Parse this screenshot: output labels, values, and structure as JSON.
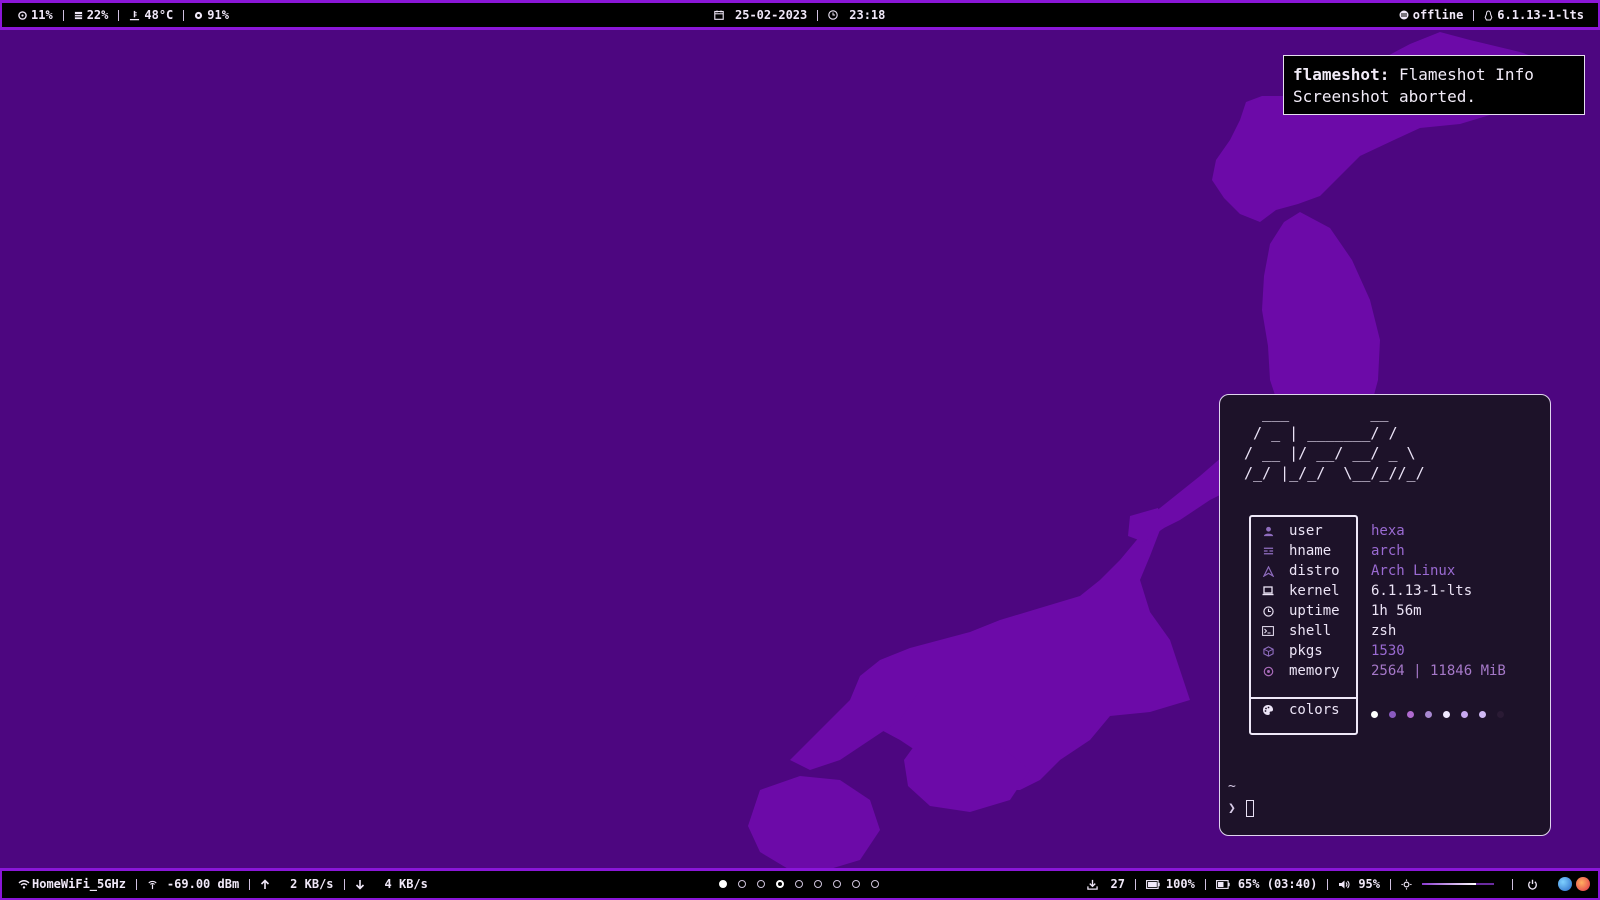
{
  "topbar": {
    "cpu": "11%",
    "ram": "22%",
    "temp": "48°C",
    "brightness": "91%",
    "date": "25-02-2023",
    "time": "23:18",
    "vpn_status": "offline",
    "kernel": "6.1.13-1-lts"
  },
  "notification": {
    "app": "flameshot:",
    "summary": "Flameshot Info",
    "body": "Screenshot aborted."
  },
  "terminal": {
    "ascii_logo": "  ___         __\n / _ | _______/ /\n/ __ |/ __/ __/ _ \\\n/_/ |_/_/  \\__/_//_/",
    "info": [
      {
        "key": "user",
        "value": "hexa",
        "icon": "user-icon"
      },
      {
        "key": "hname",
        "value": "arch",
        "icon": "hostname-icon"
      },
      {
        "key": "distro",
        "value": "Arch Linux",
        "icon": "distro-icon"
      },
      {
        "key": "kernel",
        "value": "6.1.13-1-lts",
        "icon": "laptop-icon"
      },
      {
        "key": "uptime",
        "value": "1h 56m",
        "icon": "clock-icon"
      },
      {
        "key": "shell",
        "value": "zsh",
        "icon": "terminal-icon"
      },
      {
        "key": "pkgs",
        "value": "1530",
        "icon": "package-icon"
      },
      {
        "key": "memory",
        "value": "2564 | 11846 MiB",
        "icon": "memory-icon"
      }
    ],
    "colors_label": "colors",
    "color_swatches": [
      "#ffffff",
      "#8a5ac0",
      "#b06ad0",
      "#a888d0",
      "#f0e8ff",
      "#c8a8f0",
      "#d0b8f4",
      "#2a1a34"
    ],
    "prompt_cwd": "~",
    "prompt_symbol": "❯"
  },
  "bottombar": {
    "wifi_ssid": "HomeWiFi_5GHz",
    "signal": "-69.00 dBm",
    "upload": "2 KB/s",
    "download": "4 KB/s",
    "workspaces": {
      "count": 9,
      "active": 1,
      "occupied": [
        4
      ]
    },
    "updates": "27",
    "battery_charge": "100%",
    "battery2": "65% (03:40)",
    "volume": "95%",
    "brightness_level": 0.75
  },
  "colors": {
    "accent": "#8a16d8",
    "desktop_bg": "#4d0680",
    "map_fill": "#6c0aa8",
    "terminal_bg": "#1d1229"
  }
}
